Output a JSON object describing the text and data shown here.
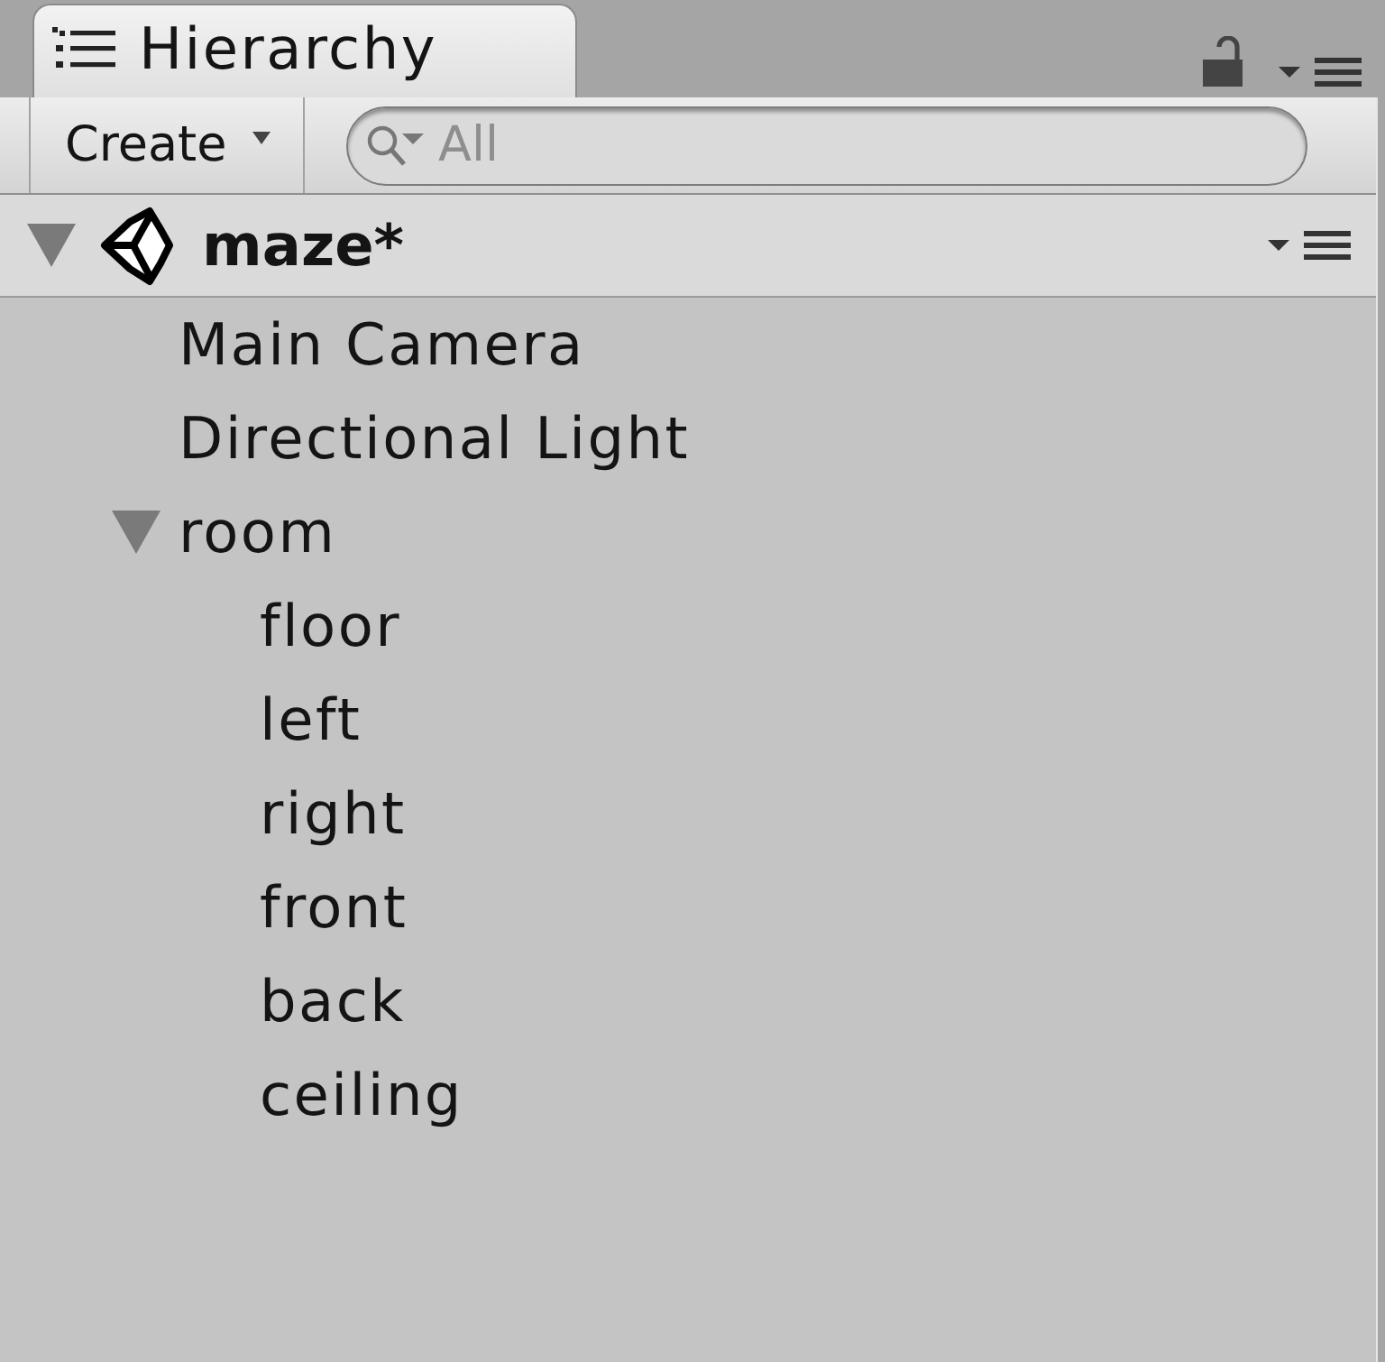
{
  "tab": {
    "title": "Hierarchy",
    "selected": true
  },
  "lock": {
    "locked": false
  },
  "toolbar": {
    "create_button": "Create",
    "search": {
      "placeholder": "All"
    }
  },
  "scene": {
    "name": "maze*",
    "expanded": true,
    "children": [
      {
        "label": "Main Camera"
      },
      {
        "label": "Directional Light"
      },
      {
        "label": "room",
        "expanded": true,
        "children": [
          {
            "label": "floor"
          },
          {
            "label": "left"
          },
          {
            "label": "right"
          },
          {
            "label": "front"
          },
          {
            "label": "back"
          },
          {
            "label": "ceiling"
          }
        ]
      }
    ]
  }
}
